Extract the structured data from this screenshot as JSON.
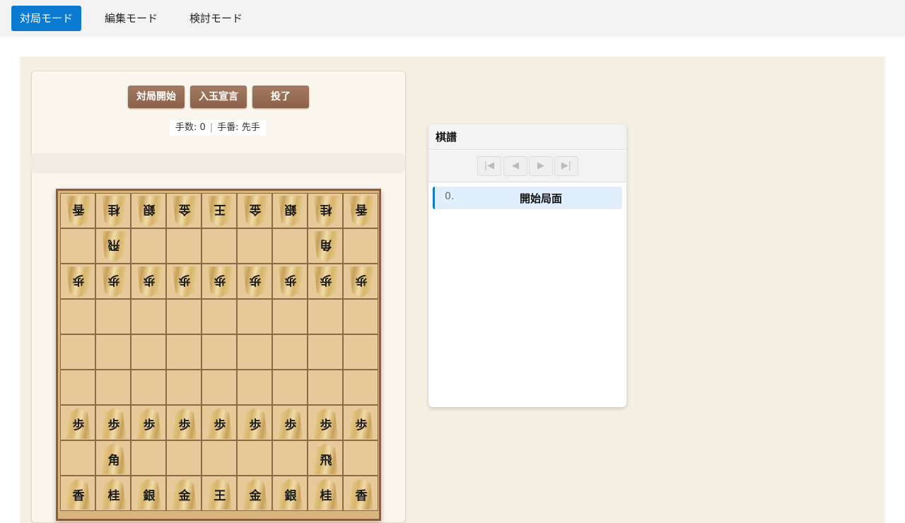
{
  "modes": [
    {
      "label": "対局モード",
      "active": true
    },
    {
      "label": "編集モード",
      "active": false
    },
    {
      "label": "検討モード",
      "active": false
    }
  ],
  "controls": {
    "start_label": "対局開始",
    "declare_label": "入玉宣言",
    "resign_label": "投了"
  },
  "status": {
    "moves_text": "手数: 0",
    "separator": "|",
    "turn_text": "手番: 先手"
  },
  "board": {
    "rows": [
      [
        "香",
        "桂",
        "銀",
        "金",
        "王",
        "金",
        "銀",
        "桂",
        "香"
      ],
      [
        "",
        "飛",
        "",
        "",
        "",
        "",
        "",
        "角",
        ""
      ],
      [
        "歩",
        "歩",
        "歩",
        "歩",
        "歩",
        "歩",
        "歩",
        "歩",
        "歩"
      ],
      [
        "",
        "",
        "",
        "",
        "",
        "",
        "",
        "",
        ""
      ],
      [
        "",
        "",
        "",
        "",
        "",
        "",
        "",
        "",
        ""
      ],
      [
        "",
        "",
        "",
        "",
        "",
        "",
        "",
        "",
        ""
      ],
      [
        "歩",
        "歩",
        "歩",
        "歩",
        "歩",
        "歩",
        "歩",
        "歩",
        "歩"
      ],
      [
        "",
        "角",
        "",
        "",
        "",
        "",
        "",
        "飛",
        ""
      ],
      [
        "香",
        "桂",
        "銀",
        "金",
        "王",
        "金",
        "銀",
        "桂",
        "香"
      ]
    ],
    "owners": [
      [
        "gote",
        "gote",
        "gote",
        "gote",
        "gote",
        "gote",
        "gote",
        "gote",
        "gote"
      ],
      [
        "",
        "gote",
        "",
        "",
        "",
        "",
        "",
        "gote",
        ""
      ],
      [
        "gote",
        "gote",
        "gote",
        "gote",
        "gote",
        "gote",
        "gote",
        "gote",
        "gote"
      ],
      [
        "",
        "",
        "",
        "",
        "",
        "",
        "",
        "",
        ""
      ],
      [
        "",
        "",
        "",
        "",
        "",
        "",
        "",
        "",
        ""
      ],
      [
        "",
        "",
        "",
        "",
        "",
        "",
        "",
        "",
        ""
      ],
      [
        "sente",
        "sente",
        "sente",
        "sente",
        "sente",
        "sente",
        "sente",
        "sente",
        "sente"
      ],
      [
        "",
        "sente",
        "",
        "",
        "",
        "",
        "",
        "sente",
        ""
      ],
      [
        "sente",
        "sente",
        "sente",
        "sente",
        "sente",
        "sente",
        "sente",
        "sente",
        "sente"
      ]
    ]
  },
  "kifu": {
    "title": "棋譜",
    "nav": [
      "|◀",
      "◀",
      "▶",
      "▶|"
    ],
    "entries": [
      {
        "num": "0.",
        "move": "開始局面"
      }
    ]
  }
}
